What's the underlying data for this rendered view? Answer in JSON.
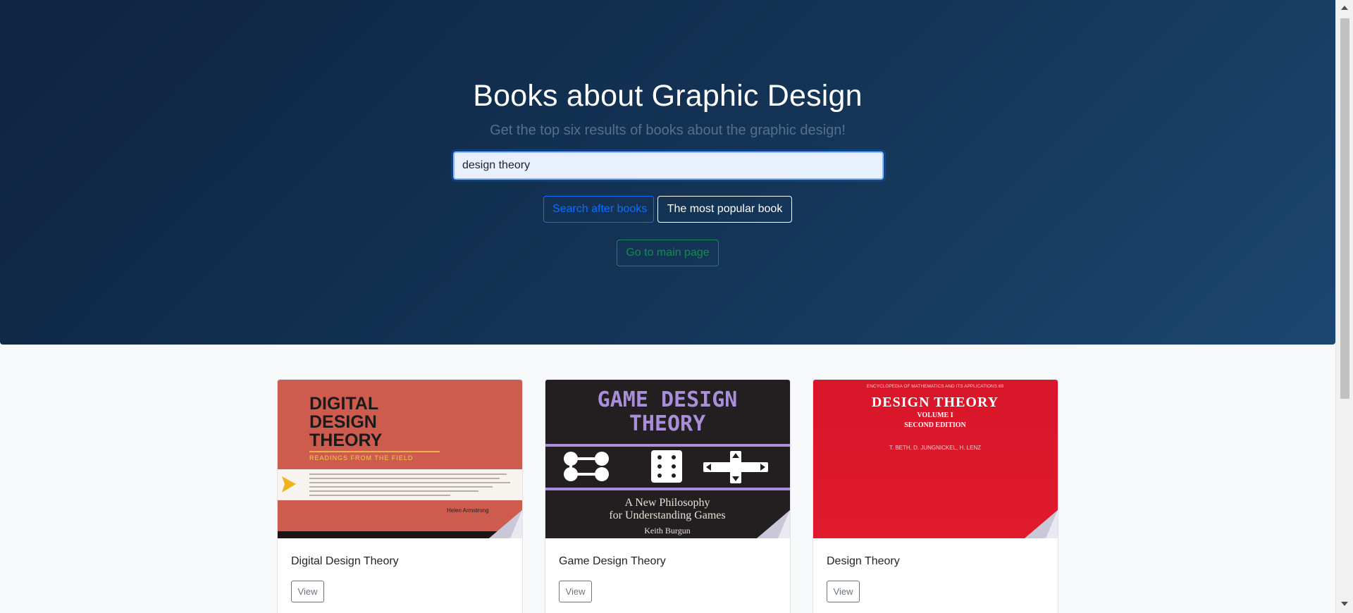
{
  "hero": {
    "title": "Books about Graphic Design",
    "subtitle": "Get the top six results of books about the graphic design!",
    "search_value": "design theory",
    "search_button": "Search after books",
    "popular_button": "The most popular book",
    "main_page_button": "Go to main page"
  },
  "books": [
    {
      "title": "Digital Design Theory",
      "view_label": "View",
      "cover": {
        "line1": "DIGITAL",
        "line2": "DESIGN",
        "line3": "THEORY",
        "tagline": "READINGS FROM THE FIELD",
        "editor": "Helen Armstrong",
        "bg_color": "#cd5c4f"
      }
    },
    {
      "title": "Game Design Theory",
      "view_label": "View",
      "cover": {
        "line1": "GAME DESIGN",
        "line2": "THEORY",
        "tagline1": "A New Philosophy",
        "tagline2": "for Understanding Games",
        "author": "Keith Burgun",
        "bg_color": "#231f20"
      }
    },
    {
      "title": "Design Theory",
      "view_label": "View",
      "cover": {
        "series": "ENCYCLOPEDIA OF MATHEMATICS AND ITS APPLICATIONS 69",
        "line1": "DESIGN THEORY",
        "volume": "VOLUME I",
        "edition": "SECOND EDITION",
        "authors": "T. BETH, D. JUNGNICKEL, H. LENZ",
        "bg_color": "#d8162a"
      }
    }
  ],
  "colors": {
    "hero_bg": "#143456",
    "primary": "#0d6efd",
    "success": "#198754",
    "secondary": "#6c757d"
  }
}
